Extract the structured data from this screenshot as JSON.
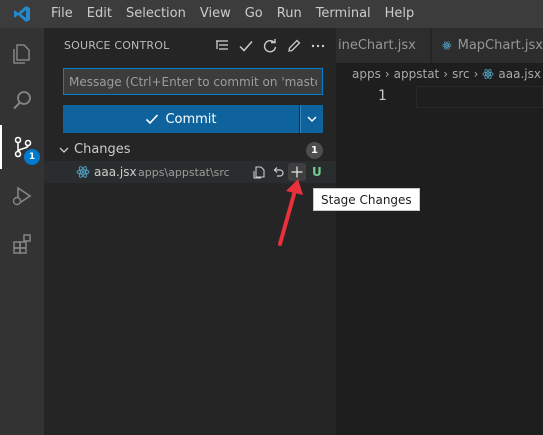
{
  "menu": [
    "File",
    "Edit",
    "Selection",
    "View",
    "Go",
    "Run",
    "Terminal",
    "Help"
  ],
  "activity": {
    "scm_badge": "1"
  },
  "sidebar": {
    "title": "SOURCE CONTROL",
    "message_placeholder": "Message (Ctrl+Enter to commit on 'master')",
    "commit_label": "Commit",
    "changes_label": "Changes",
    "changes_count": "1",
    "file": {
      "name": "aaa.jsx",
      "path": "apps\\appstat\\src",
      "status": "U"
    }
  },
  "tooltip": "Stage Changes",
  "tabs": [
    "ineChart.jsx",
    "MapChart.jsx"
  ],
  "breadcrumb": [
    "apps",
    "appstat",
    "src",
    "aaa.jsx"
  ],
  "editor": {
    "line_number": "1"
  },
  "colors": {
    "accent": "#007acc",
    "commit_button": "#0e639c",
    "untracked": "#73c991",
    "react_icon": "#519aba",
    "arrow": "#e8313b"
  }
}
